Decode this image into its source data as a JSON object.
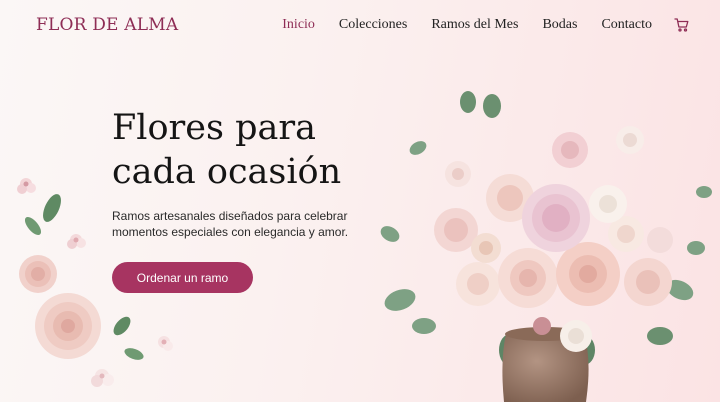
{
  "brand": {
    "name": "FLOR DE ALMA"
  },
  "nav": {
    "items": [
      {
        "label": "Inicio",
        "active": true
      },
      {
        "label": "Colecciones",
        "active": false
      },
      {
        "label": "Ramos del Mes",
        "active": false
      },
      {
        "label": "Bodas",
        "active": false
      },
      {
        "label": "Contacto",
        "active": false
      }
    ],
    "cart_icon": "shopping-cart-icon"
  },
  "hero": {
    "title_line1": "Flores para",
    "title_line2": "cada ocasión",
    "subtitle": "Ramos artesanales diseñados para celebrar momentos especiales con elegancia y amor.",
    "cta_label": "Ordenar un ramo"
  },
  "colors": {
    "accent": "#a73461",
    "brand": "#8e2d55",
    "background": "#fbf1f0"
  }
}
